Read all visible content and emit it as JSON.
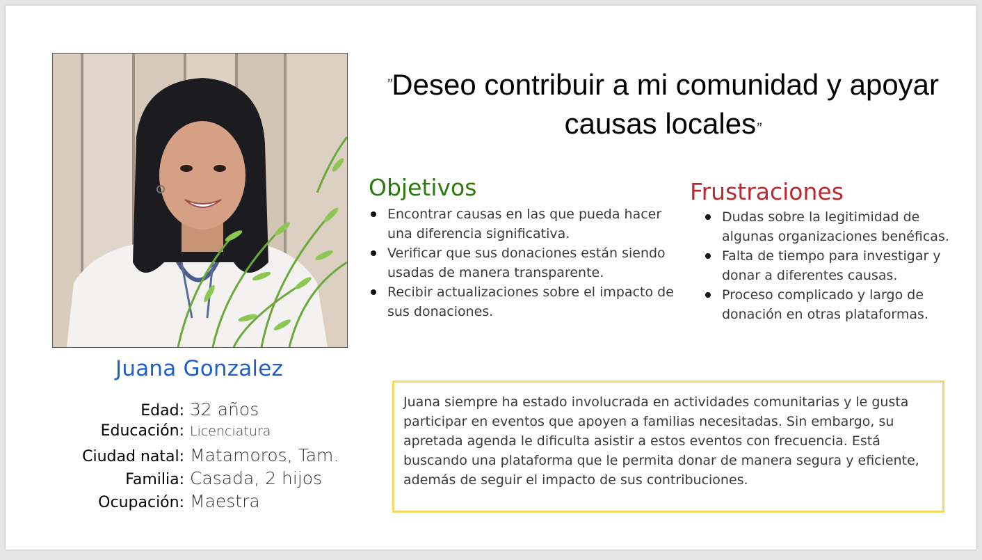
{
  "persona": {
    "name": "Juana Gonzalez",
    "photo_alt": "Juana Gonzalez"
  },
  "details": [
    {
      "label": "Edad:",
      "value": "32 años"
    },
    {
      "label": "Educación:",
      "value": "Licenciatura"
    },
    {
      "label": "Ciudad natal:",
      "value": "Matamoros, Tam."
    },
    {
      "label": "Familia:",
      "value": "Casada, 2 hijos"
    },
    {
      "label": "Ocupación:",
      "value": "Maestra"
    }
  ],
  "quote": {
    "open_mark": "”",
    "text": "Deseo contribuir a mi comunidad y apoyar causas locales",
    "close_mark": "”"
  },
  "objectives": {
    "title": "Objetivos",
    "items": [
      "Encontrar causas en las que pueda hacer una diferencia significativa.",
      "Verificar que sus donaciones están siendo usadas de manera transparente.",
      "Recibir actualizaciones sobre el impacto de sus donaciones."
    ]
  },
  "frustrations": {
    "title": "Frustraciones",
    "items": [
      "Dudas sobre la legitimidad de algunas organizaciones benéficas.",
      "Falta de tiempo para investigar y donar a diferentes causas.",
      "Proceso complicado y largo de donación en otras plataformas."
    ]
  },
  "bio": "Juana siempre ha estado involucrada en actividades comunitarias y le gusta participar en eventos que apoyen a familias necesitadas. Sin embargo, su apretada agenda le dificulta asistir a estos eventos con frecuencia. Está buscando una plataforma que le permita donar de manera segura y eficiente, además de seguir el impacto de sus contribuciones.",
  "colors": {
    "name": "#1f5fc8",
    "objectives_title": "#2d7a0f",
    "frustrations_title": "#c0272d",
    "bio_border": "#f5d863"
  }
}
